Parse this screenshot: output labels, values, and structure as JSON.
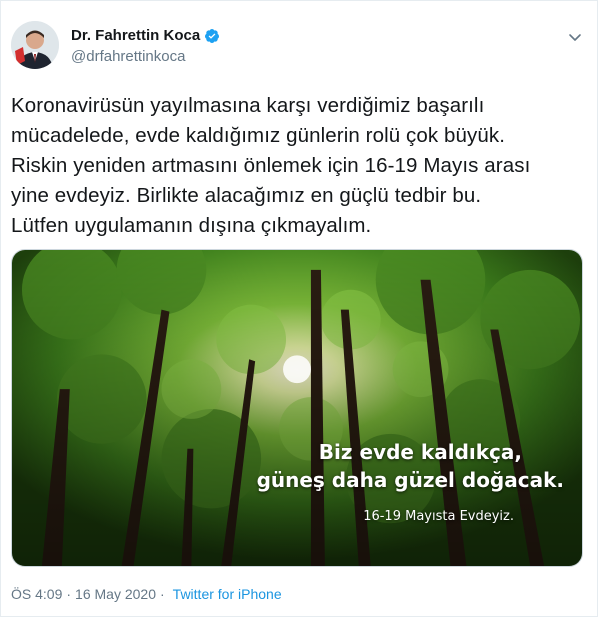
{
  "author": {
    "name": "Dr. Fahrettin Koca",
    "handle": "@drfahrettinkoca",
    "verified": true,
    "verified_color": "#1da1f2"
  },
  "tweet": {
    "lines": [
      "Koronavirüsün yayılmasına karşı verdiğimiz başarılı",
      "mücadelede, evde kaldığımız günlerin rolü çok büyük.",
      "Riskin yeniden artmasını önlemek için 16-19 Mayıs arası",
      "yine evdeyiz. Birlikte alacağımız en güçlü tedbir bu.",
      "Lütfen uygulamanın dışına çıkmayalım."
    ]
  },
  "media": {
    "description_icon": "forest-photo",
    "overlay_line1": "Biz evde kaldıkça,",
    "overlay_line2": "güneş daha güzel doğacak.",
    "overlay_line3": "16-19 Mayısta Evdeyiz."
  },
  "footer": {
    "time": "ÖS 4:09",
    "separator": "·",
    "date": "16 May 2020",
    "source": "Twitter for iPhone"
  },
  "colors": {
    "text": "#14171a",
    "muted": "#657786",
    "link": "#1b95e0",
    "border": "#e6ecf0"
  }
}
